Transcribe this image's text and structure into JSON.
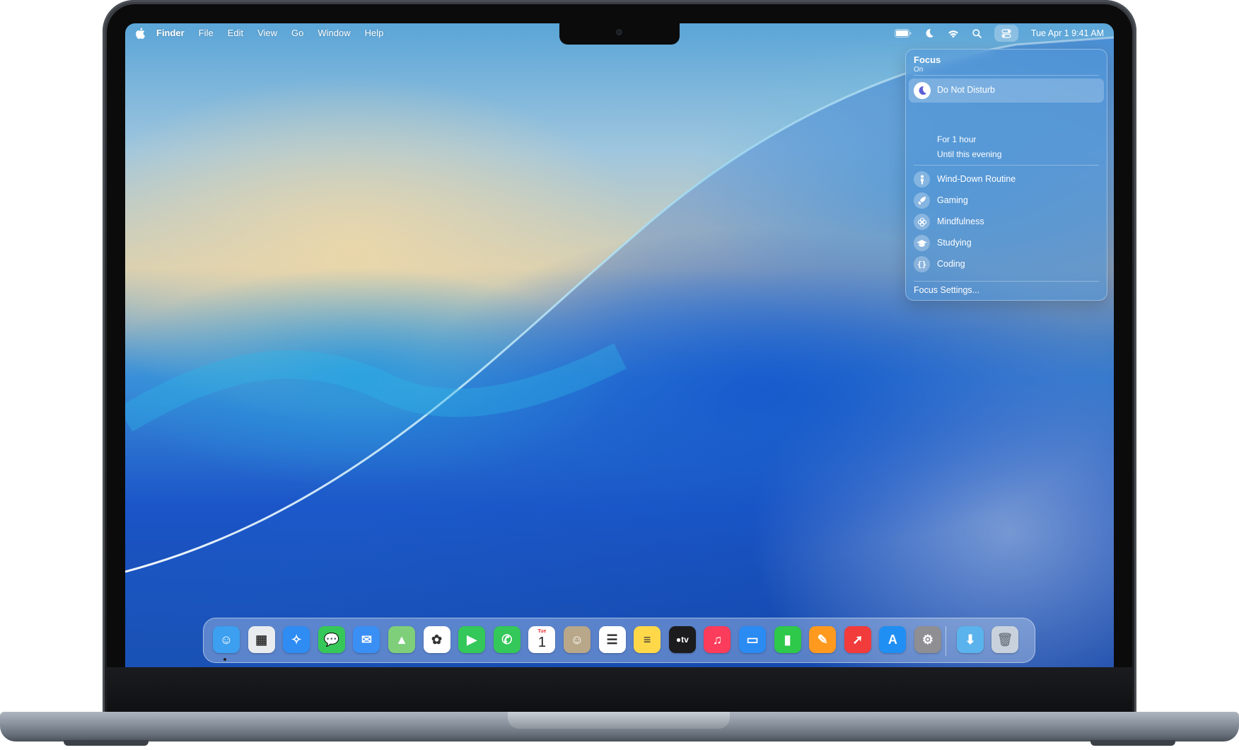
{
  "menubar": {
    "apple_icon": "apple-logo",
    "app_name": "Finder",
    "menus": [
      "File",
      "Edit",
      "View",
      "Go",
      "Window",
      "Help"
    ],
    "status_icons": [
      "battery-icon",
      "moon-icon",
      "wifi-icon",
      "search-icon",
      "control-center-icon"
    ],
    "clock": "Tue Apr 1  9:41 AM"
  },
  "focus_panel": {
    "title": "Focus",
    "status": "On",
    "do_not_disturb": {
      "label": "Do Not Disturb",
      "icon": "moon-icon"
    },
    "durations": [
      "For 1 hour",
      "Until this evening"
    ],
    "modes": [
      {
        "label": "Wind-Down Routine",
        "icon": "person-icon"
      },
      {
        "label": "Gaming",
        "icon": "rocket-icon"
      },
      {
        "label": "Mindfulness",
        "icon": "flower-icon"
      },
      {
        "label": "Studying",
        "icon": "graduation-cap-icon"
      },
      {
        "label": "Coding",
        "icon": "braces-icon"
      }
    ],
    "settings_label": "Focus Settings..."
  },
  "dock": {
    "apps": [
      {
        "name": "Finder",
        "icon": "finder-icon",
        "color": "#3c9ff0",
        "running": true
      },
      {
        "name": "Launchpad",
        "icon": "launchpad-icon",
        "color": "#e9ecef"
      },
      {
        "name": "Safari",
        "icon": "safari-icon",
        "color": "#2f8cf2"
      },
      {
        "name": "Messages",
        "icon": "messages-icon",
        "color": "#36c759"
      },
      {
        "name": "Mail",
        "icon": "mail-icon",
        "color": "#3a8ff5"
      },
      {
        "name": "Maps",
        "icon": "maps-icon",
        "color": "#7fcf7a"
      },
      {
        "name": "Photos",
        "icon": "photos-icon",
        "color": "#ffffff"
      },
      {
        "name": "FaceTime",
        "icon": "facetime-icon",
        "color": "#34c759"
      },
      {
        "name": "Phone",
        "icon": "phone-icon",
        "color": "#34c759"
      },
      {
        "name": "Calendar",
        "icon": "calendar-icon",
        "color": "#ffffff",
        "month": "Tue",
        "day": "1"
      },
      {
        "name": "Contacts",
        "icon": "contacts-icon",
        "color": "#b9a78a"
      },
      {
        "name": "Reminders",
        "icon": "reminders-icon",
        "color": "#ffffff"
      },
      {
        "name": "Notes",
        "icon": "notes-icon",
        "color": "#ffd84a"
      },
      {
        "name": "TV",
        "icon": "tv-icon",
        "color": "#1c1c1e",
        "label": "tv"
      },
      {
        "name": "Music",
        "icon": "music-icon",
        "color": "#fb3c5a"
      },
      {
        "name": "Keynote",
        "icon": "keynote-icon",
        "color": "#2a8bf2"
      },
      {
        "name": "Numbers",
        "icon": "numbers-icon",
        "color": "#2ec84a"
      },
      {
        "name": "Pages",
        "icon": "pages-icon",
        "color": "#ff9a1f"
      },
      {
        "name": "Rocket",
        "icon": "rocket-app-icon",
        "color": "#f23b3b"
      },
      {
        "name": "App Store",
        "icon": "app-store-icon",
        "color": "#1f8ff3"
      },
      {
        "name": "System Settings",
        "icon": "settings-gear-icon",
        "color": "#8e8e93"
      }
    ],
    "extras": [
      {
        "name": "Downloads",
        "icon": "downloads-folder-icon",
        "color": "#5ab3ec"
      },
      {
        "name": "Trash",
        "icon": "trash-icon",
        "color": "#c9d2dc"
      }
    ]
  }
}
